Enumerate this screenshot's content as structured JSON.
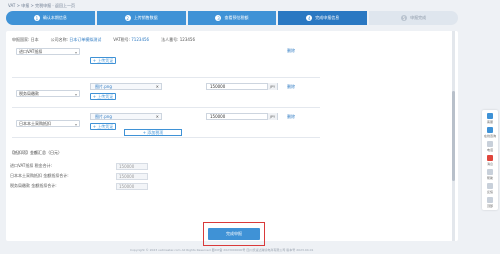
{
  "breadcrumb": "VAT > 申报 > 完税申报 · 返回上一页",
  "steps": [
    {
      "num": "1",
      "label": "确认本期信息"
    },
    {
      "num": "2",
      "label": "上传销售数据"
    },
    {
      "num": "3",
      "label": "查看预估税额"
    },
    {
      "num": "4",
      "label": "完成申报信息"
    },
    {
      "num": "5",
      "label": "申报完成"
    }
  ],
  "info": {
    "country_label": "申报国家:",
    "country": "日本",
    "company_label": "公司名称:",
    "company": "日本订单模拟测试",
    "vat_label": "VAT税号:",
    "vat": "7123456",
    "corp_label": "法人番号:",
    "corp": "123456"
  },
  "rows": [
    {
      "country": "进口VAT抵扣",
      "file": "",
      "amount": "",
      "upload": "+ 上传凭证",
      "delete": "删除"
    },
    {
      "country": "税务局缴款",
      "file": "图片.png",
      "amount": "150000",
      "unit": "JPY",
      "upload": "+ 上传凭证",
      "delete": "删除"
    },
    {
      "country": "日本本土采购抵扣",
      "file": "图片.png",
      "amount": "150000",
      "unit": "JPY",
      "upload": "+ 上传凭证",
      "delete": "删除"
    }
  ],
  "add_country": "+ 添加税项",
  "summary": {
    "title": "【抵扣项】金额汇总（日元）",
    "lines": [
      {
        "label": "进口VAT抵扣 税金合计:",
        "value": "150000"
      },
      {
        "label": "日本本土采购抵扣 金额抵扣合计:",
        "value": "150000"
      },
      {
        "label": "税务局缴款 金额抵扣合计:",
        "value": "150000"
      }
    ]
  },
  "submit": "完成申报",
  "footer": "Copyright © 2023 vatmaster.com All Rights Reserved  蜀ICP备 2023000000号  四川凯速达跨境电商有限公司  版本号 2023.04.01",
  "sidebar": [
    {
      "icon": "user-icon",
      "label": "客服"
    },
    {
      "icon": "chat-icon",
      "label": "在线咨询"
    },
    {
      "icon": "phone-icon",
      "label": "电话"
    },
    {
      "icon": "alert-icon",
      "label": "消息"
    },
    {
      "icon": "help-icon",
      "label": "帮助"
    },
    {
      "icon": "feedback-icon",
      "label": "反馈"
    },
    {
      "icon": "top-icon",
      "label": "顶部"
    }
  ]
}
